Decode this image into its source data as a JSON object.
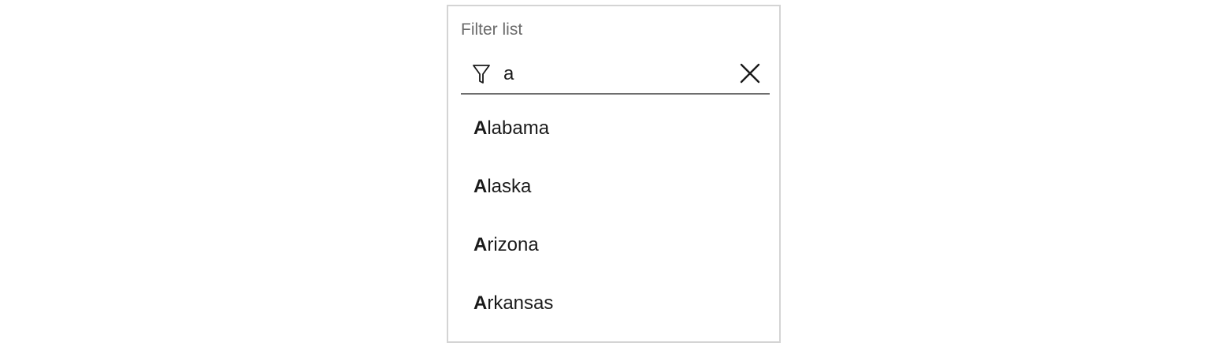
{
  "filter": {
    "label": "Filter list",
    "value": "a",
    "icon": "filter-icon",
    "clear_icon": "close-icon"
  },
  "results": [
    {
      "match": "A",
      "rest": "labama"
    },
    {
      "match": "A",
      "rest": "laska"
    },
    {
      "match": "A",
      "rest": "rizona"
    },
    {
      "match": "A",
      "rest": "rkansas"
    }
  ]
}
